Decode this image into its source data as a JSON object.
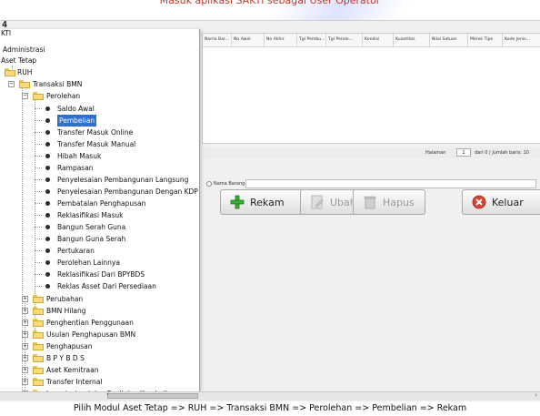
{
  "top_caption": "Masuk aplikasi SAKTI sebagai User Operator",
  "bottom_caption": "Pilih Modul Aset Tetap => RUH => Transaksi BMN => Perolehan => Pembelian => Rekam",
  "app_icon_text": "4",
  "tree": {
    "root": "KTI",
    "items": [
      {
        "label": "Administrasi"
      },
      {
        "label": "Aset Tetap"
      },
      {
        "label": "RUH"
      },
      {
        "label": "Transaksi BMN"
      },
      {
        "label": "Perolehan"
      },
      {
        "label": "Saldo Awal"
      },
      {
        "label": "Pembelian"
      },
      {
        "label": "Transfer Masuk Online"
      },
      {
        "label": "Transfer Masuk Manual"
      },
      {
        "label": "Hibah Masuk"
      },
      {
        "label": "Rampasan"
      },
      {
        "label": "Penyelesaian Pembangunan Langsung"
      },
      {
        "label": "Penyelesaian Pembangunan Dengan KDP"
      },
      {
        "label": "Pembatalan Penghapusan"
      },
      {
        "label": "Reklasifikasi Masuk"
      },
      {
        "label": "Bangun Serah Guna"
      },
      {
        "label": "Bangun Guna Serah"
      },
      {
        "label": "Pertukaran"
      },
      {
        "label": "Perolehan Lainnya"
      },
      {
        "label": "Reklasifikasi Dari BPYBDS"
      },
      {
        "label": "Reklas Asset Dari Persediaan"
      },
      {
        "label": "Perubahan"
      },
      {
        "label": "BMN Hilang"
      },
      {
        "label": "Penghentian Penggunaan"
      },
      {
        "label": "Usulan Penghapusan BMN"
      },
      {
        "label": "Penghapusan"
      },
      {
        "label": "B P Y B D S"
      },
      {
        "label": "Aset Kemitraan"
      },
      {
        "label": "Transfer Internal"
      },
      {
        "label": "Inventarisasi dan Penilaian Kembali"
      }
    ]
  },
  "grid": {
    "columns": [
      "Nama Bar...",
      "No Awal",
      "No Akhir",
      "Tgl Pembu...",
      "Tgl Perole...",
      "Kondisi",
      "Kuantitas",
      "Nilai Satuan",
      "Merek Tipe",
      "Kode Jenis..."
    ]
  },
  "paging": {
    "halaman_label": "Halaman",
    "page_value": "1",
    "of_text": "dari 0",
    "jumlah_text": "Jumlah baris:",
    "jumlah_value": "10"
  },
  "search": {
    "radio_label": "Nama Barang",
    "value": ""
  },
  "buttons": {
    "rekam": "Rekam",
    "ubah": "Ubah",
    "hapus": "Hapus",
    "keluar": "Keluar"
  },
  "colors": {
    "selection": "#2f6fd1",
    "caption_red": "#c0392b",
    "rekam_icon": "#3aa935",
    "keluar_icon": "#d9412f"
  }
}
